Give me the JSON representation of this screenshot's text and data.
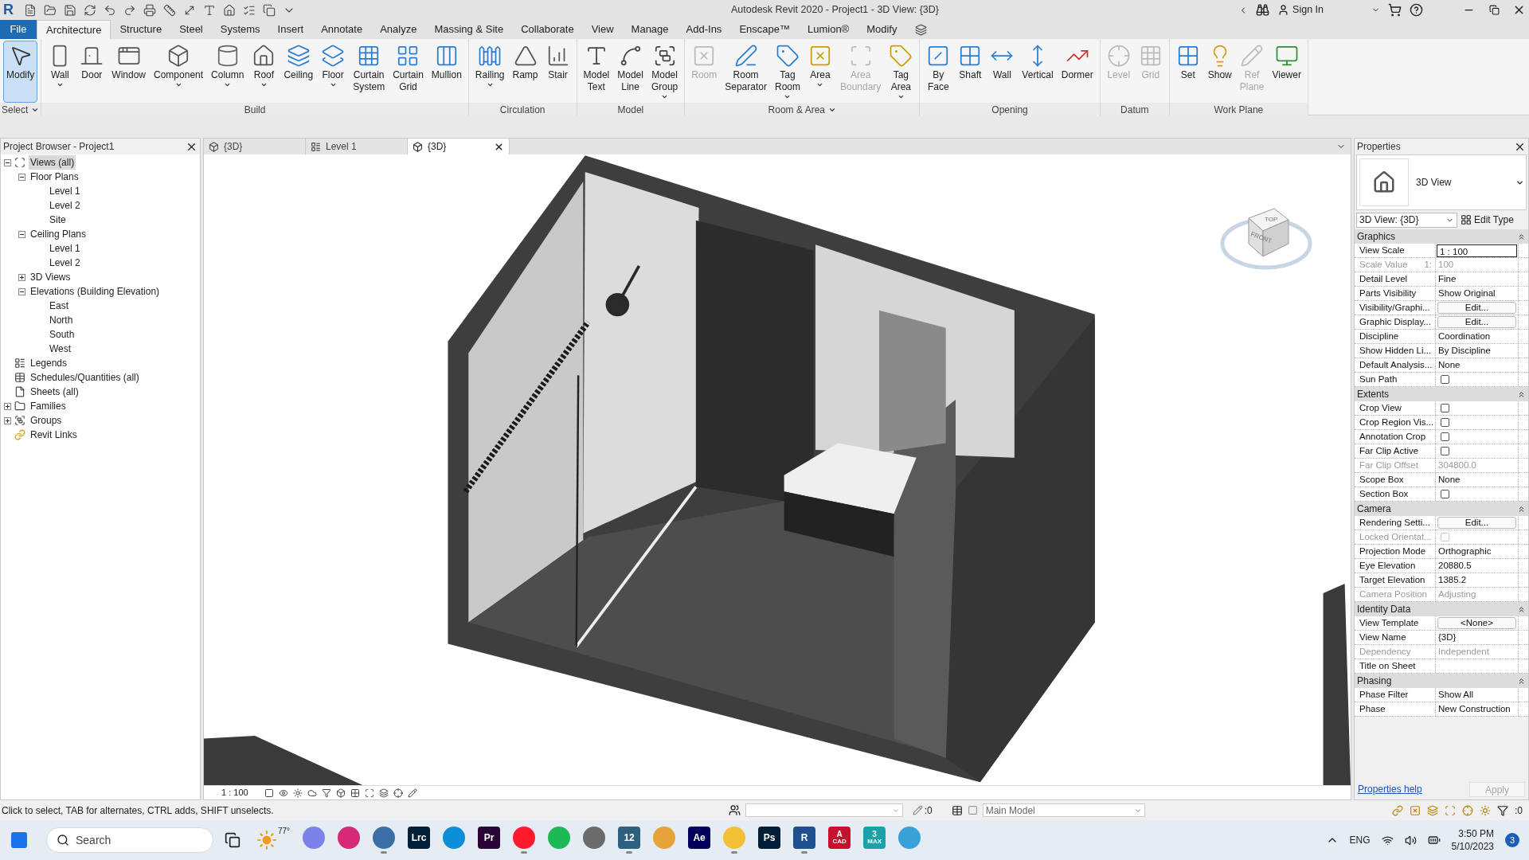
{
  "title_bar": {
    "logo": "R",
    "title": "Autodesk Revit 2020 - Project1 - 3D View: {3D}",
    "sign_in": "Sign In"
  },
  "ribbon": {
    "file_tab": "File",
    "tabs": [
      {
        "label": "Architecture",
        "selected": true
      },
      {
        "label": "Structure",
        "selected": false
      },
      {
        "label": "Steel",
        "selected": false
      },
      {
        "label": "Systems",
        "selected": false
      },
      {
        "label": "Insert",
        "selected": false
      },
      {
        "label": "Annotate",
        "selected": false
      },
      {
        "label": "Analyze",
        "selected": false
      },
      {
        "label": "Massing & Site",
        "selected": false
      },
      {
        "label": "Collaborate",
        "selected": false
      },
      {
        "label": "View",
        "selected": false
      },
      {
        "label": "Manage",
        "selected": false
      },
      {
        "label": "Add-Ins",
        "selected": false
      },
      {
        "label": "Enscape™",
        "selected": false
      },
      {
        "label": "Lumion®",
        "selected": false
      },
      {
        "label": "Modify",
        "selected": false
      }
    ],
    "panels": [
      {
        "title": "Select",
        "menu": true,
        "tools": [
          {
            "label": "Modify",
            "selected": true,
            "disabled": false,
            "dropdown": false
          }
        ]
      },
      {
        "title": "Build",
        "menu": false,
        "tools": [
          {
            "label": "Wall",
            "selected": false,
            "disabled": false,
            "dropdown": true
          },
          {
            "label": "Door",
            "selected": false,
            "disabled": false,
            "dropdown": false
          },
          {
            "label": "Window",
            "selected": false,
            "disabled": false,
            "dropdown": false
          },
          {
            "label": "Component",
            "selected": false,
            "disabled": false,
            "dropdown": true
          },
          {
            "label": "Column",
            "selected": false,
            "disabled": false,
            "dropdown": true
          },
          {
            "label": "Roof",
            "selected": false,
            "disabled": false,
            "dropdown": true
          },
          {
            "label": "Ceiling",
            "selected": false,
            "disabled": false,
            "dropdown": false
          },
          {
            "label": "Floor",
            "selected": false,
            "disabled": false,
            "dropdown": true
          },
          {
            "label": "Curtain System",
            "selected": false,
            "disabled": false,
            "dropdown": false
          },
          {
            "label": "Curtain Grid",
            "selected": false,
            "disabled": false,
            "dropdown": false
          },
          {
            "label": "Mullion",
            "selected": false,
            "disabled": false,
            "dropdown": false
          }
        ]
      },
      {
        "title": "Circulation",
        "menu": false,
        "tools": [
          {
            "label": "Railing",
            "selected": false,
            "disabled": false,
            "dropdown": true
          },
          {
            "label": "Ramp",
            "selected": false,
            "disabled": false,
            "dropdown": false
          },
          {
            "label": "Stair",
            "selected": false,
            "disabled": false,
            "dropdown": false
          }
        ]
      },
      {
        "title": "Model",
        "menu": false,
        "tools": [
          {
            "label": "Model Text",
            "selected": false,
            "disabled": false,
            "dropdown": false
          },
          {
            "label": "Model Line",
            "selected": false,
            "disabled": false,
            "dropdown": false
          },
          {
            "label": "Model Group",
            "selected": false,
            "disabled": false,
            "dropdown": true
          }
        ]
      },
      {
        "title": "Room & Area",
        "menu": true,
        "tools": [
          {
            "label": "Room",
            "selected": false,
            "disabled": true,
            "dropdown": false
          },
          {
            "label": "Room Separator",
            "selected": false,
            "disabled": false,
            "dropdown": false
          },
          {
            "label": "Tag Room",
            "selected": false,
            "disabled": false,
            "dropdown": true
          },
          {
            "label": "Area",
            "selected": false,
            "disabled": false,
            "dropdown": true
          },
          {
            "label": "Area Boundary",
            "selected": false,
            "disabled": true,
            "dropdown": false
          },
          {
            "label": "Tag Area",
            "selected": false,
            "disabled": false,
            "dropdown": true
          }
        ]
      },
      {
        "title": "Opening",
        "menu": false,
        "tools": [
          {
            "label": "By Face",
            "selected": false,
            "disabled": false,
            "dropdown": false
          },
          {
            "label": "Shaft",
            "selected": false,
            "disabled": false,
            "dropdown": false
          },
          {
            "label": "Wall",
            "selected": false,
            "disabled": false,
            "dropdown": false
          },
          {
            "label": "Vertical",
            "selected": false,
            "disabled": false,
            "dropdown": false
          },
          {
            "label": "Dormer",
            "selected": false,
            "disabled": false,
            "dropdown": false
          }
        ]
      },
      {
        "title": "Datum",
        "menu": false,
        "tools": [
          {
            "label": "Level",
            "selected": false,
            "disabled": true,
            "dropdown": false
          },
          {
            "label": "Grid",
            "selected": false,
            "disabled": true,
            "dropdown": false
          }
        ]
      },
      {
        "title": "Work Plane",
        "menu": false,
        "tools": [
          {
            "label": "Set",
            "selected": false,
            "disabled": false,
            "dropdown": false
          },
          {
            "label": "Show",
            "selected": false,
            "disabled": false,
            "dropdown": false
          },
          {
            "label": "Ref Plane",
            "selected": false,
            "disabled": true,
            "dropdown": false
          },
          {
            "label": "Viewer",
            "selected": false,
            "disabled": false,
            "dropdown": false
          }
        ]
      }
    ]
  },
  "project_browser": {
    "title": "Project Browser - Project1",
    "tree": [
      {
        "label": "Views (all)",
        "expanded": true,
        "selected": true,
        "children": [
          {
            "label": "Floor Plans",
            "expanded": true,
            "selected": false,
            "children": [
              {
                "label": "Level 1",
                "selected": false
              },
              {
                "label": "Level 2",
                "selected": false
              },
              {
                "label": "Site",
                "selected": false
              }
            ]
          },
          {
            "label": "Ceiling Plans",
            "expanded": true,
            "selected": false,
            "children": [
              {
                "label": "Level 1",
                "selected": false
              },
              {
                "label": "Level 2",
                "selected": false
              }
            ]
          },
          {
            "label": "3D Views",
            "expanded": false,
            "selected": false
          },
          {
            "label": "Elevations (Building Elevation)",
            "expanded": true,
            "selected": false,
            "children": [
              {
                "label": "East",
                "selected": false
              },
              {
                "label": "North",
                "selected": false
              },
              {
                "label": "South",
                "selected": false
              },
              {
                "label": "West",
                "selected": false
              }
            ]
          }
        ]
      },
      {
        "label": "Legends",
        "selected": false
      },
      {
        "label": "Schedules/Quantities (all)",
        "selected": false
      },
      {
        "label": "Sheets (all)",
        "selected": false
      },
      {
        "label": "Families",
        "expanded": false,
        "selected": false
      },
      {
        "label": "Groups",
        "expanded": false,
        "selected": false
      },
      {
        "label": "Revit Links",
        "selected": false
      }
    ]
  },
  "view_tabs": [
    {
      "label": "{3D}",
      "kind": "model",
      "selected": false
    },
    {
      "label": "Level 1",
      "kind": "plan",
      "selected": false
    },
    {
      "label": "{3D}",
      "kind": "model",
      "selected": true
    }
  ],
  "view_cube": {
    "top": "TOP",
    "front": "FRONT"
  },
  "view_control": {
    "scale": "1 : 100"
  },
  "properties": {
    "title": "Properties",
    "type_name": "3D View",
    "selector": "3D View: {3D}",
    "edit_type": "Edit Type",
    "groups": [
      {
        "title": "Graphics",
        "rows": [
          {
            "label": "View Scale",
            "value": "1 : 100",
            "kind": "input",
            "disabled": false
          },
          {
            "label": "Scale Value",
            "suffix": "1:",
            "value": "100",
            "kind": "text",
            "disabled": true
          },
          {
            "label": "Detail Level",
            "value": "Fine",
            "kind": "text",
            "disabled": false
          },
          {
            "label": "Parts Visibility",
            "value": "Show Original",
            "kind": "text",
            "disabled": false
          },
          {
            "label": "Visibility/Graphi...",
            "value": "Edit...",
            "kind": "button",
            "disabled": false
          },
          {
            "label": "Graphic Display...",
            "value": "Edit...",
            "kind": "button",
            "disabled": false
          },
          {
            "label": "Discipline",
            "value": "Coordination",
            "kind": "text",
            "disabled": false
          },
          {
            "label": "Show Hidden Li...",
            "value": "By Discipline",
            "kind": "text",
            "disabled": false
          },
          {
            "label": "Default Analysis...",
            "value": "None",
            "kind": "text",
            "disabled": false
          },
          {
            "label": "Sun Path",
            "kind": "checkbox",
            "checked": false,
            "disabled": false
          }
        ]
      },
      {
        "title": "Extents",
        "rows": [
          {
            "label": "Crop View",
            "kind": "checkbox",
            "checked": false,
            "disabled": false
          },
          {
            "label": "Crop Region Vis...",
            "kind": "checkbox",
            "checked": false,
            "disabled": false
          },
          {
            "label": "Annotation Crop",
            "kind": "checkbox",
            "checked": false,
            "disabled": false
          },
          {
            "label": "Far Clip Active",
            "kind": "checkbox",
            "checked": false,
            "disabled": false
          },
          {
            "label": "Far Clip Offset",
            "value": "304800.0",
            "kind": "text",
            "disabled": true
          },
          {
            "label": "Scope Box",
            "value": "None",
            "kind": "text",
            "disabled": false
          },
          {
            "label": "Section Box",
            "kind": "checkbox",
            "checked": false,
            "disabled": false
          }
        ]
      },
      {
        "title": "Camera",
        "rows": [
          {
            "label": "Rendering Setti...",
            "value": "Edit...",
            "kind": "button",
            "disabled": false
          },
          {
            "label": "Locked Orientat...",
            "kind": "checkbox",
            "checked": false,
            "disabled": true
          },
          {
            "label": "Projection Mode",
            "value": "Orthographic",
            "kind": "text",
            "disabled": false
          },
          {
            "label": "Eye Elevation",
            "value": "20880.5",
            "kind": "text",
            "disabled": false
          },
          {
            "label": "Target Elevation",
            "value": "1385.2",
            "kind": "text",
            "disabled": false
          },
          {
            "label": "Camera Position",
            "value": "Adjusting",
            "kind": "text",
            "disabled": true
          }
        ]
      },
      {
        "title": "Identity Data",
        "rows": [
          {
            "label": "View Template",
            "value": "<None>",
            "kind": "button",
            "disabled": false
          },
          {
            "label": "View Name",
            "value": "{3D}",
            "kind": "text",
            "disabled": false
          },
          {
            "label": "Dependency",
            "value": "Independent",
            "kind": "text",
            "disabled": true
          },
          {
            "label": "Title on Sheet",
            "kind": "text",
            "disabled": false
          }
        ]
      },
      {
        "title": "Phasing",
        "rows": [
          {
            "label": "Phase Filter",
            "value": "Show All",
            "kind": "text",
            "disabled": false
          },
          {
            "label": "Phase",
            "value": "New Construction",
            "kind": "text",
            "disabled": false
          }
        ]
      }
    ],
    "help": "Properties help",
    "apply": "Apply",
    "apply_disabled": true
  },
  "status_bar": {
    "hint": "Click to select, TAB for alternates, CTRL adds, SHIFT unselects.",
    "editable_count": ":0",
    "model": "Main Model",
    "filter_count": ":0"
  },
  "taskbar": {
    "search": "Search",
    "weather": "77°",
    "apps": [
      {
        "color": "#7b83eb",
        "running": false
      },
      {
        "color": "#d62976",
        "running": false
      },
      {
        "color": "#3a6ea5",
        "running": true
      },
      {
        "label": "Lrc",
        "color": "#001e36",
        "running": false
      },
      {
        "color": "#0c8fd8",
        "running": false
      },
      {
        "label": "Pr",
        "color": "#2a0634",
        "running": false
      },
      {
        "color": "#ff1b2d",
        "running": true
      },
      {
        "color": "#1db954",
        "running": false
      },
      {
        "color": "#6b6b6b",
        "running": false
      },
      {
        "label": "12",
        "color": "#2d5f7f",
        "running": true
      },
      {
        "color": "#e8a23a",
        "running": false
      },
      {
        "label": "Ae",
        "color": "#00005b",
        "running": false
      },
      {
        "color": "#f2c037",
        "running": true
      },
      {
        "label": "Ps",
        "color": "#001e36",
        "running": false
      },
      {
        "label": "R",
        "color": "#1d4f91",
        "running": true
      },
      {
        "label": "A",
        "sub": "CAD",
        "color": "#c8102e",
        "running": false
      },
      {
        "label": "3",
        "sub": "MAX",
        "color": "#1ba1a8",
        "running": false
      },
      {
        "color": "#3aa0d8",
        "running": false
      }
    ],
    "language": "ENG",
    "time": "3:50 PM",
    "date": "5/10/2023",
    "notifications": "3"
  }
}
